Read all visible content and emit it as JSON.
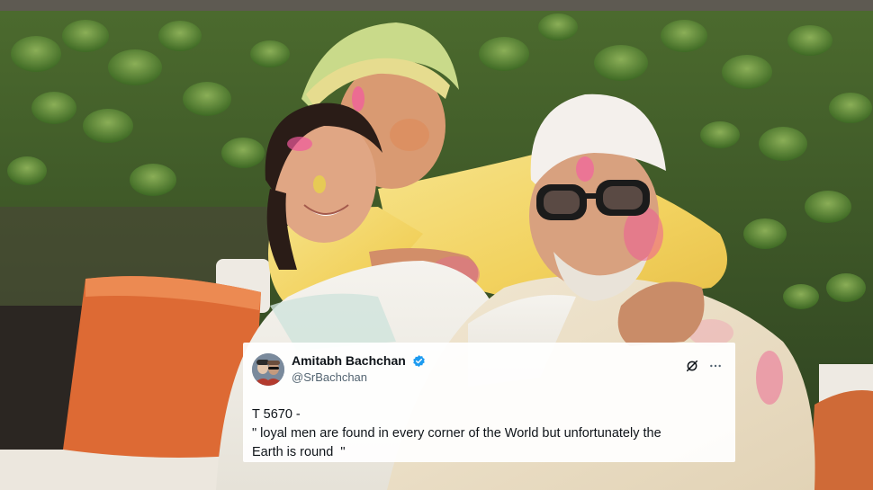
{
  "photo": {
    "subject": "family-holi-portrait-icon"
  },
  "tweet": {
    "display_name": "Amitabh Bachchan",
    "handle": "@SrBachchan",
    "lines": [
      "T 5670 -",
      "\" loyal men are found in every corner of the World but unfortunately the",
      "Earth is round  \""
    ],
    "verified_color": "#1d9bf0"
  },
  "colors": {
    "card_background": "#ffffff",
    "text_primary": "#0f1419",
    "text_secondary": "#536471",
    "verified": "#1d9bf0"
  }
}
